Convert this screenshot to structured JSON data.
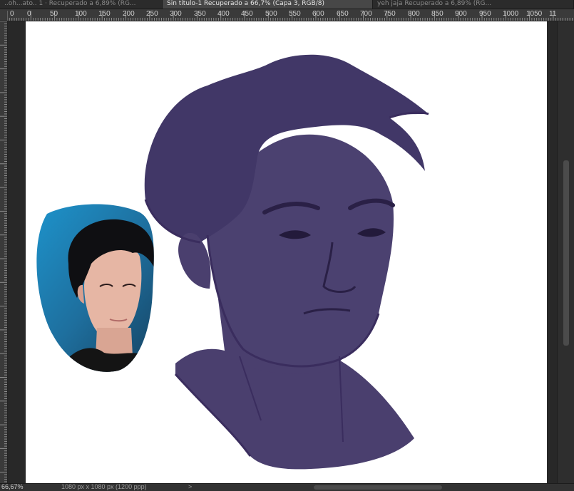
{
  "tabs": [
    {
      "label": "..oh...ato.. 1 · Recuperado a 6,89% (RG...",
      "active": false
    },
    {
      "label": "Sin título-1 Recuperado a 66,7% (Capa 3, RGB/8)",
      "active": true
    },
    {
      "label": "yeh jaja Recuperado a 6,89% (RG...",
      "active": false
    }
  ],
  "ruler": {
    "top_labels": [
      "0",
      "0",
      "50",
      "100",
      "150",
      "200",
      "250",
      "300",
      "350",
      "400",
      "450",
      "500",
      "550",
      "600",
      "650",
      "700",
      "750",
      "800",
      "850",
      "900",
      "950",
      "1000",
      "1050",
      "11"
    ]
  },
  "status": {
    "zoom": "66,67%",
    "doc_info": "1080 px x 1080 px (1200 ppp)",
    "nav_arrow": ">"
  },
  "colors": {
    "canvas": "#ffffff",
    "workspace": "#282828",
    "sketch_fill": "#4a3f6e",
    "sketch_line": "#3a2d5e",
    "photo_bg": "#1f8fc4"
  },
  "icons": {
    "status_arrow": "chevron-right-icon"
  }
}
